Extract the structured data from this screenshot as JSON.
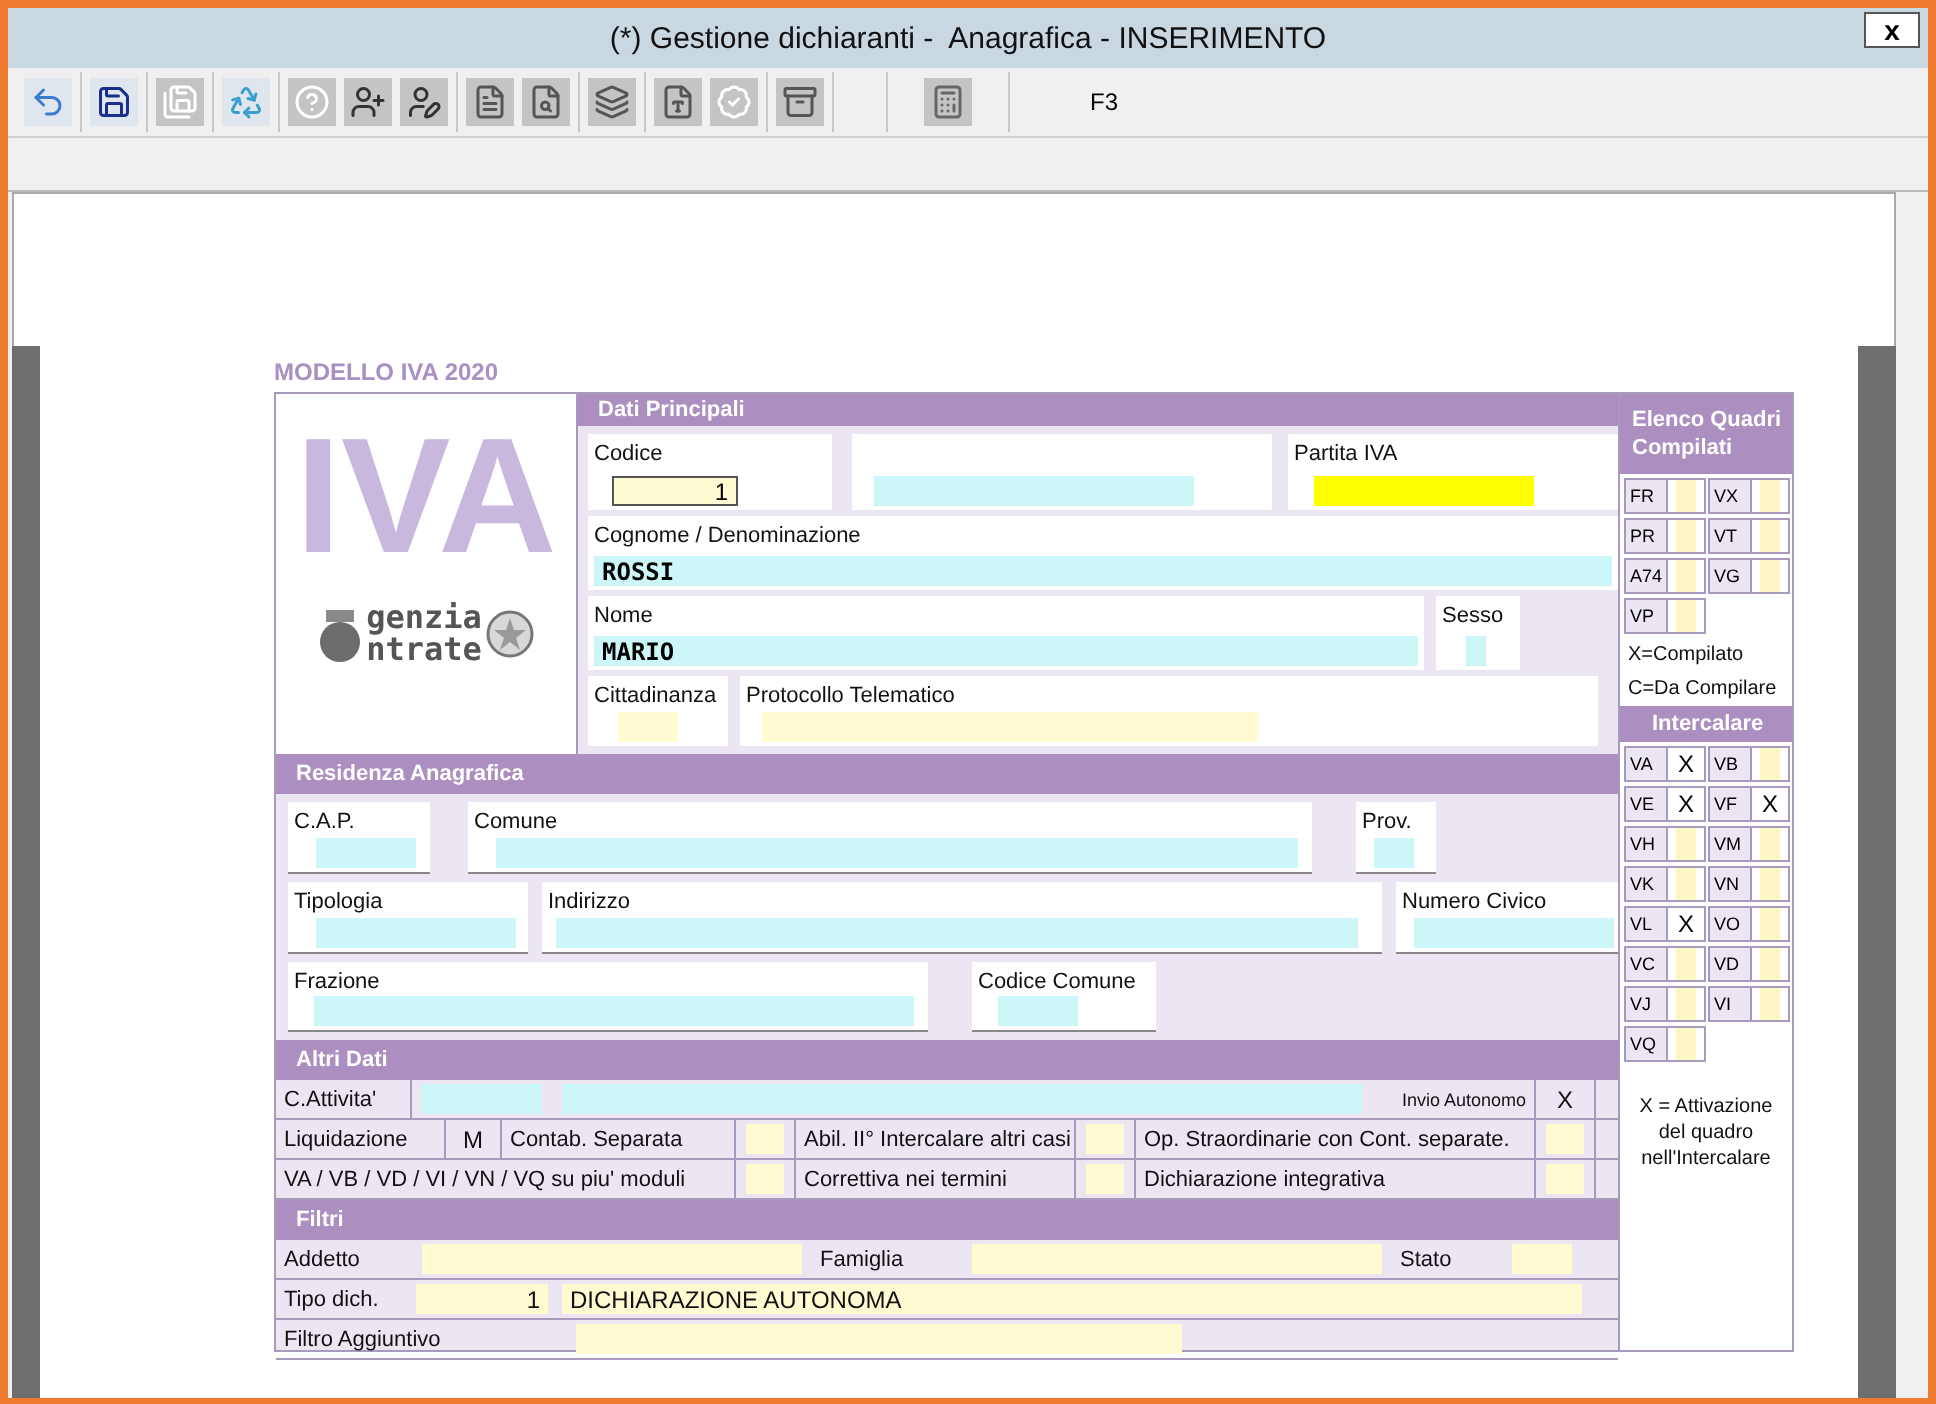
{
  "window": {
    "title": "(*) Gestione dichiaranti -  Anagrafica - INSERIMENTO",
    "close": "x"
  },
  "toolbar": {
    "groups": [
      {
        "buttons": [
          {
            "kind": "undo"
          }
        ]
      },
      {
        "buttons": [
          {
            "kind": "save"
          }
        ]
      },
      {
        "buttons": [
          {
            "kind": "save-copy"
          }
        ]
      },
      {
        "buttons": [
          {
            "kind": "recycle"
          }
        ]
      },
      {
        "buttons": [
          {
            "kind": "help"
          },
          {
            "kind": "person-add"
          },
          {
            "kind": "person-edit"
          }
        ]
      },
      {
        "buttons": [
          {
            "kind": "document"
          },
          {
            "kind": "document-search"
          }
        ]
      },
      {
        "buttons": [
          {
            "kind": "layers"
          }
        ]
      },
      {
        "buttons": [
          {
            "kind": "pdf"
          },
          {
            "kind": "check"
          }
        ]
      },
      {
        "buttons": [
          {
            "kind": "cabinet"
          }
        ]
      },
      {
        "buttons": [
          {
            "kind": "calculator"
          }
        ]
      }
    ],
    "shortcut": "F3"
  },
  "form": {
    "title": "MODELLO IVA 2020",
    "logo": {
      "mark": "IVA",
      "line_1": "genzia",
      "line_2": "ntrate"
    },
    "dati_principali": {
      "title": "Dati Principali",
      "rows": [
        [
          {
            "label": "Codice",
            "value": "1",
            "kind": "focused"
          },
          {
            "kind": "lookup"
          },
          {
            "label": "Partita IVA",
            "kind": "required"
          }
        ],
        [
          {
            "label": "Cognome / Denominazione",
            "value": "ROSSI",
            "kind": "lookup"
          }
        ],
        [
          {
            "label": "Nome",
            "value": "MARIO",
            "kind": "lookup"
          },
          {
            "label": "Sesso",
            "kind": "lookup"
          }
        ],
        [
          {
            "label": "Cittadinanza",
            "kind": "text"
          },
          {
            "label": "Protocollo Telematico",
            "kind": "text"
          }
        ]
      ]
    },
    "residenza": {
      "title": "Residenza Anagrafica",
      "rows": [
        [
          {
            "label": "C.A.P.",
            "kind": "lookup"
          },
          {
            "label": "Comune",
            "kind": "lookup"
          },
          {
            "label": "Prov.",
            "kind": "lookup"
          }
        ],
        [
          {
            "label": "Tipologia",
            "kind": "lookup"
          },
          {
            "label": "Indirizzo",
            "kind": "lookup"
          },
          {
            "label": "Numero Civico",
            "kind": "lookup"
          }
        ],
        [
          {
            "label": "Frazione",
            "kind": "lookup"
          },
          {
            "label": "Codice Comune",
            "kind": "lookup"
          }
        ]
      ]
    },
    "altri_dati": {
      "title": "Altri Dati",
      "attivita": {
        "label": "C.Attivita'",
        "codes": [
          {
            "kind": "lookup"
          },
          {
            "kind": "lookup"
          }
        ]
      },
      "invio": {
        "label": "Invio Autonomo",
        "value": "X"
      },
      "rows": [
        {
          "pairs": [
            {
              "label": "Liquidazione",
              "value": "M"
            },
            {
              "label": "Contab. Separata"
            },
            {
              "label": "Abil. II° Intercalare altri casi"
            },
            {
              "label": "Op. Straordinarie con Cont. separate."
            }
          ]
        },
        {
          "pairs": [
            {
              "label": "VA / VB / VD / VI / VN / VQ su piu' moduli"
            },
            {
              "label": "Correttiva nei termini"
            },
            {
              "label": "Dichiarazione integrativa"
            }
          ]
        }
      ]
    },
    "filtri": {
      "title": "Filtri",
      "rows": [
        [
          {
            "kind": "label",
            "text": "Addetto"
          },
          {
            "kind": "field"
          },
          {
            "kind": "label",
            "text": "Famiglia"
          },
          {
            "kind": "field"
          },
          {
            "kind": "label",
            "text": "Stato"
          },
          {
            "kind": "field"
          }
        ],
        [
          {
            "kind": "label",
            "text": "Tipo dich."
          },
          {
            "kind": "field",
            "value": "1"
          },
          {
            "kind": "field",
            "value": "DICHIARAZIONE AUTONOMA"
          }
        ],
        [
          {
            "kind": "label",
            "text": "Filtro Aggiuntivo"
          },
          {
            "kind": "field"
          }
        ]
      ]
    },
    "quadri": {
      "title": "Elenco Quadri Compilati",
      "cells": [
        {
          "code": "FR"
        },
        {
          "code": "VX"
        },
        {
          "code": "PR"
        },
        {
          "code": "VT"
        },
        {
          "code": "A74"
        },
        {
          "code": "VG"
        },
        {
          "code": "VP"
        }
      ],
      "legend": [
        "X=Compilato",
        "C=Da Compilare"
      ]
    },
    "intercalare": {
      "title": "Intercalare",
      "cells": [
        {
          "code": "VA",
          "value": "X"
        },
        {
          "code": "VB"
        },
        {
          "code": "VE",
          "value": "X"
        },
        {
          "code": "VF",
          "value": "X"
        },
        {
          "code": "VH"
        },
        {
          "code": "VM"
        },
        {
          "code": "VK"
        },
        {
          "code": "VN"
        },
        {
          "code": "VL",
          "value": "X"
        },
        {
          "code": "VO"
        },
        {
          "code": "VC"
        },
        {
          "code": "VD"
        },
        {
          "code": "VJ"
        },
        {
          "code": "VI"
        },
        {
          "code": "VQ"
        }
      ],
      "legend": "X = Attivazione del quadro nell'Intercalare"
    }
  }
}
